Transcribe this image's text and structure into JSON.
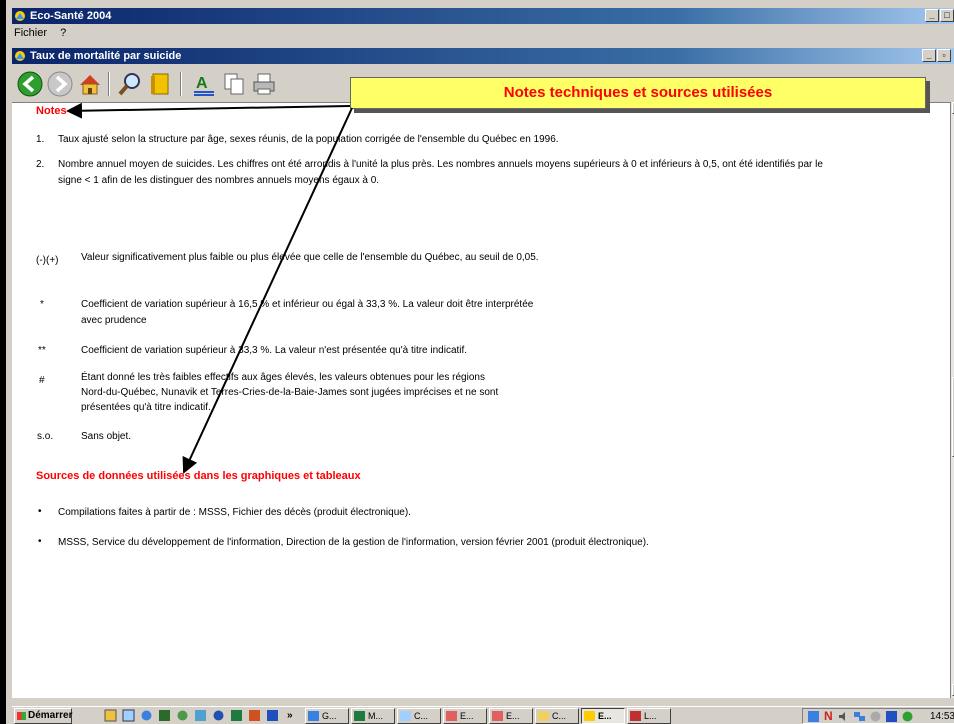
{
  "app": {
    "title": "Eco-Santé 2004",
    "menu": [
      "Fichier",
      "?"
    ],
    "child_title": "Taux de mortalité par suicide"
  },
  "toolbar": {
    "icons": [
      "back-icon",
      "forward-icon",
      "home-icon",
      "search-icon",
      "book-icon",
      "text-icon",
      "copy-icon",
      "print-icon"
    ]
  },
  "callout": "Notes techniques et sources utilisées",
  "notes": {
    "heading": "Notes",
    "n1_num": "1.",
    "n1_text": "Taux ajusté selon la structure par âge, sexes réunis, de la population corrigée de l'ensemble du Québec en 1996.",
    "n2_num": "2.",
    "n2_line1": "Nombre annuel moyen de suicides. Les chiffres ont été arrondis à l'unité la plus près. Les nombres annuels moyens supérieurs à 0 et inférieurs à 0,5, ont été identifiés par le",
    "n2_line2": "signe < 1 afin de les distinguer des nombres annuels moyens égaux à 0.",
    "legend": [
      {
        "sym": "(-)(+)",
        "text": "Valeur significativement plus faible ou plus élevée que celle de l'ensemble du Québec, au seuil de 0,05."
      },
      {
        "sym": "*",
        "text": "Coefficient de variation supérieur à 16,5 % et inférieur ou égal à 33,3 %. La valeur doit être interprétée",
        "text2": "avec prudence"
      },
      {
        "sym": "**",
        "text": "Coefficient de variation supérieur à 33,3 %. La valeur n'est présentée qu'à titre indicatif."
      },
      {
        "sym": "#",
        "text": "Étant donné les très faibles effectifs aux âges élevés, les valeurs obtenues pour les régions",
        "text2": "Nord-du-Québec, Nunavik et Terres-Cries-de-la-Baie-James sont jugées imprécises et ne sont",
        "text3": "présentées qu'à titre indicatif."
      },
      {
        "sym": "s.o.",
        "text": "Sans objet."
      }
    ]
  },
  "sources": {
    "heading": "Sources de données utilisées dans les graphiques et tableaux",
    "items": [
      "Compilations faites à partir de : MSSS, Fichier des décès (produit électronique).",
      "MSSS, Service du développement de l'information, Direction de la gestion de l'information, version février 2001 (produit électronique)."
    ],
    "bullet": "•"
  },
  "taskbar": {
    "start": "Démarrer",
    "more": "»",
    "tasks": [
      "G...",
      "M...",
      "C...",
      "E...",
      "E...",
      "C...",
      "E...",
      "L..."
    ],
    "tray_letter": "N",
    "clock": "14:53"
  }
}
